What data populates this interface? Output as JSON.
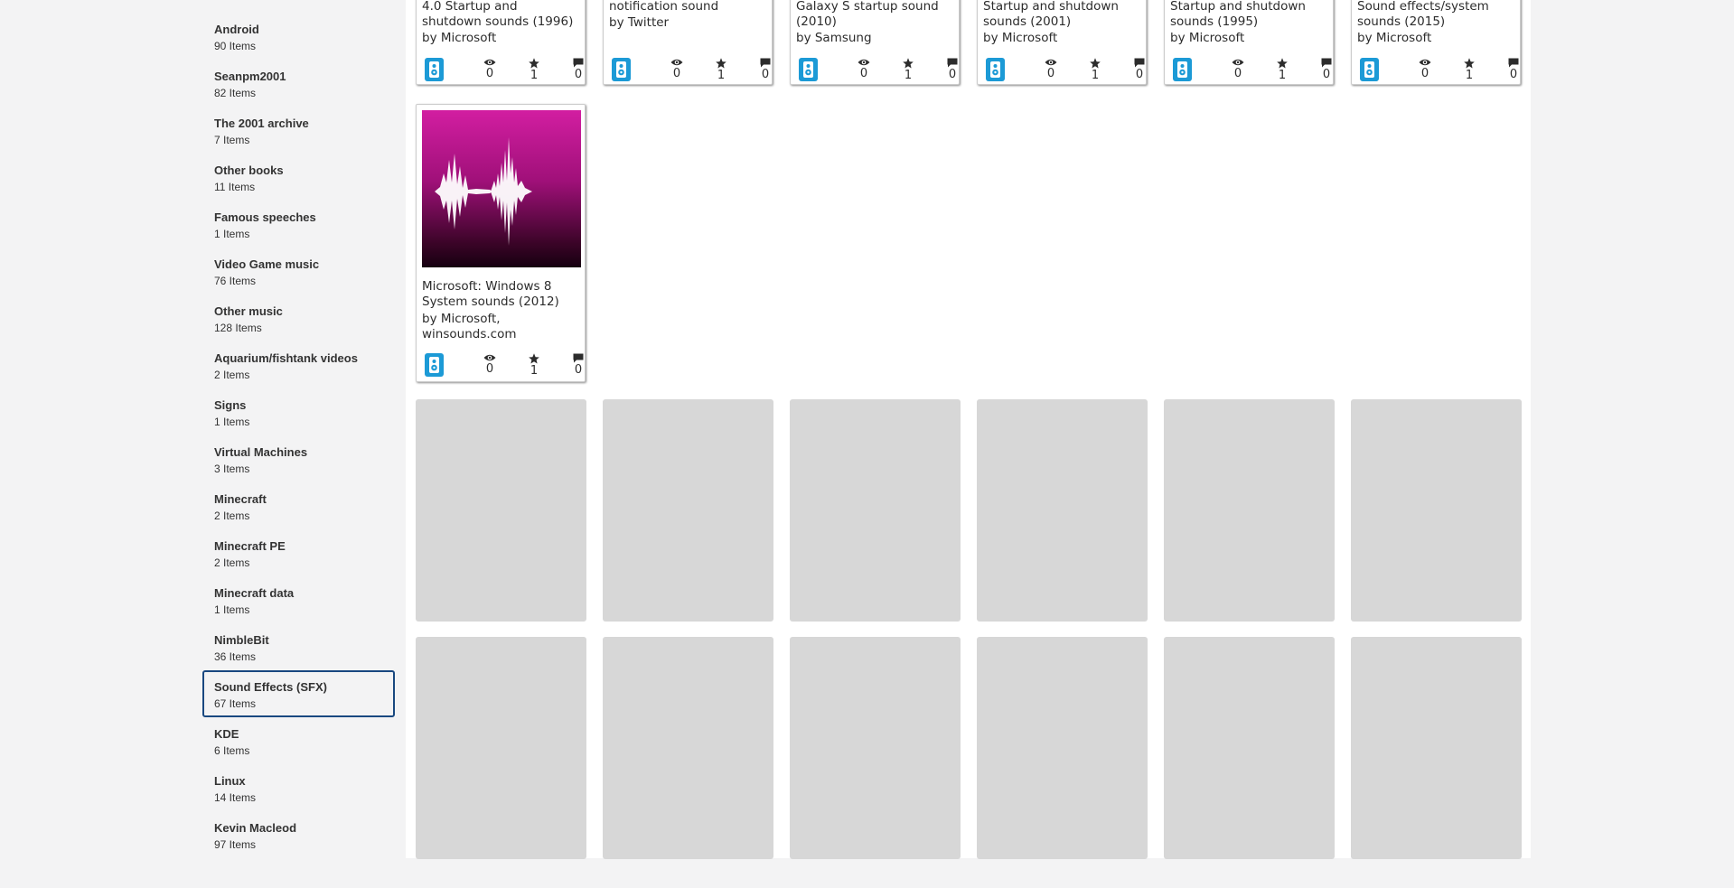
{
  "sidebar": {
    "items": [
      {
        "name": "Android",
        "count": "90 Items"
      },
      {
        "name": "Seanpm2001",
        "count": "82 Items"
      },
      {
        "name": "The 2001 archive",
        "count": "7 Items"
      },
      {
        "name": "Other books",
        "count": "11 Items"
      },
      {
        "name": "Famous speeches",
        "count": "1 Items"
      },
      {
        "name": "Video Game music",
        "count": "76 Items"
      },
      {
        "name": "Other music",
        "count": "128 Items"
      },
      {
        "name": "Aquarium/fishtank videos",
        "count": "2 Items"
      },
      {
        "name": "Signs",
        "count": "1 Items"
      },
      {
        "name": "Virtual Machines",
        "count": "3 Items"
      },
      {
        "name": "Minecraft",
        "count": "2 Items"
      },
      {
        "name": "Minecraft PE",
        "count": "2 Items"
      },
      {
        "name": "Minecraft data",
        "count": "1 Items"
      },
      {
        "name": "NimbleBit",
        "count": "36 Items"
      },
      {
        "name": "Sound Effects (SFX)",
        "count": "67 Items",
        "selected": true
      },
      {
        "name": "KDE",
        "count": "6 Items"
      },
      {
        "name": "Linux",
        "count": "14 Items"
      },
      {
        "name": "Kevin Macleod",
        "count": "97 Items"
      }
    ]
  },
  "cards": [
    {
      "title_line": "4.0 Startup and",
      "title_line2": "shutdown sounds (1996)",
      "by": "by Microsoft",
      "views": "0",
      "favorites": "1",
      "reviews": "0",
      "media_icon": "audio-icon"
    },
    {
      "title_line": "notification sound",
      "by": "by Twitter",
      "views": "0",
      "favorites": "1",
      "reviews": "0",
      "media_icon": "audio-icon"
    },
    {
      "title_line": "Galaxy S startup sound",
      "title_line2": "(2010)",
      "by": "by Samsung",
      "views": "0",
      "favorites": "1",
      "reviews": "0",
      "media_icon": "audio-icon"
    },
    {
      "title_line": "Startup and shutdown",
      "title_line2": "sounds (2001)",
      "by": "by Microsoft",
      "views": "0",
      "favorites": "1",
      "reviews": "0",
      "media_icon": "audio-icon"
    },
    {
      "title_line": "Startup and shutdown",
      "title_line2": "sounds (1995)",
      "by": "by Microsoft",
      "views": "0",
      "favorites": "1",
      "reviews": "0",
      "media_icon": "audio-icon"
    },
    {
      "title_line": "Sound effects/system",
      "title_line2": "sounds (2015)",
      "by": "by Microsoft",
      "views": "0",
      "favorites": "1",
      "reviews": "0",
      "media_icon": "audio-icon"
    }
  ],
  "featured_card": {
    "title_line": "Microsoft: Windows 8",
    "title_line2": "System sounds (2012)",
    "by_line": "by Microsoft,",
    "by_line2": "winsounds.com",
    "views": "0",
    "favorites": "1",
    "reviews": "0",
    "media_icon": "audio-icon",
    "thumbnail": "waveform-thumbnail"
  },
  "colors": {
    "accent": "#1c9ad6",
    "selected_border": "#194880",
    "placeholder": "#d7d7d7"
  }
}
